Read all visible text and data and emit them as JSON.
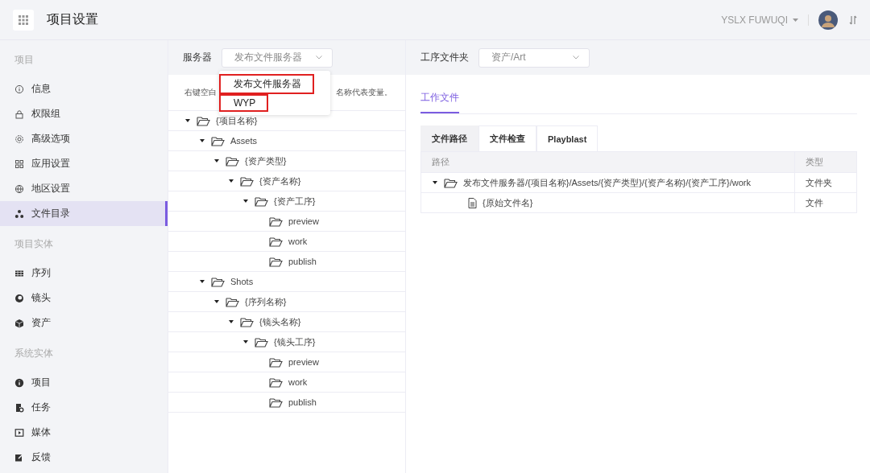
{
  "header": {
    "title": "项目设置",
    "user": "YSLX FUWUQI"
  },
  "sidebar": {
    "sections": [
      {
        "label": "项目",
        "items": [
          {
            "label": "信息",
            "kind": "info",
            "selected": false
          },
          {
            "label": "权限组",
            "kind": "lock",
            "selected": false
          },
          {
            "label": "高级选项",
            "kind": "gear",
            "selected": false
          },
          {
            "label": "应用设置",
            "kind": "grid",
            "selected": false
          },
          {
            "label": "地区设置",
            "kind": "globe",
            "selected": false
          },
          {
            "label": "文件目录",
            "kind": "nodes",
            "selected": true
          }
        ]
      },
      {
        "label": "项目实体",
        "items": [
          {
            "label": "序列",
            "kind": "film",
            "selected": false
          },
          {
            "label": "镜头",
            "kind": "lens",
            "selected": false
          },
          {
            "label": "资产",
            "kind": "cube",
            "selected": false
          }
        ]
      },
      {
        "label": "系统实体",
        "items": [
          {
            "label": "项目",
            "kind": "info-solid",
            "selected": false
          },
          {
            "label": "任务",
            "kind": "task",
            "selected": false
          },
          {
            "label": "媒体",
            "kind": "media",
            "selected": false
          },
          {
            "label": "反馈",
            "kind": "edit",
            "selected": false
          }
        ]
      }
    ]
  },
  "server_panel": {
    "label": "服务器",
    "select_value": "发布文件服务器",
    "dropdown": [
      {
        "label": "发布文件服务器",
        "highlighted": true
      },
      {
        "label": "WYP",
        "highlighted": true
      }
    ],
    "hint_start": "右键空白",
    "hint_end": "名称代表变量。",
    "tree": [
      {
        "label": "{项目名称}",
        "expanded": true,
        "children": [
          {
            "label": "Assets",
            "expanded": true,
            "children": [
              {
                "label": "{资产类型}",
                "expanded": true,
                "children": [
                  {
                    "label": "{资产名称}",
                    "expanded": true,
                    "children": [
                      {
                        "label": "{资产工序}",
                        "expanded": true,
                        "children": [
                          {
                            "label": "preview"
                          },
                          {
                            "label": "work"
                          },
                          {
                            "label": "publish"
                          }
                        ]
                      }
                    ]
                  }
                ]
              }
            ]
          },
          {
            "label": "Shots",
            "expanded": true,
            "children": [
              {
                "label": "{序列名称}",
                "expanded": true,
                "children": [
                  {
                    "label": "{镜头名称}",
                    "expanded": true,
                    "children": [
                      {
                        "label": "{镜头工序}",
                        "expanded": true,
                        "children": [
                          {
                            "label": "preview"
                          },
                          {
                            "label": "work"
                          },
                          {
                            "label": "publish"
                          }
                        ]
                      }
                    ]
                  }
                ]
              }
            ]
          }
        ]
      }
    ]
  },
  "folder_panel": {
    "label": "工序文件夹",
    "select_value": "资产/Art",
    "tabs": [
      {
        "label": "工作文件",
        "selected": true
      }
    ],
    "subtabs": [
      {
        "label": "文件路径",
        "selected": true
      },
      {
        "label": "文件检查",
        "selected": false
      },
      {
        "label": "Playblast",
        "selected": false
      }
    ],
    "table": {
      "columns": [
        "路径",
        "类型"
      ],
      "rows": [
        {
          "kind": "folder",
          "path": "发布文件服务器/{项目名称}/Assets/{资产类型}/{资产名称}/{资产工序}/work",
          "type": "文件夹",
          "expanded": true,
          "children": [
            {
              "kind": "file",
              "path": "{原始文件名}",
              "type": "文件"
            }
          ]
        }
      ]
    }
  }
}
